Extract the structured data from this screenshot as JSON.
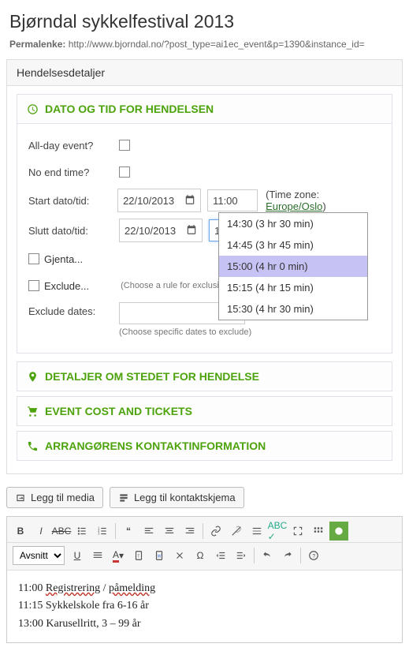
{
  "page_title": "Bjørndal sykkelfestival 2013",
  "permalink": {
    "label": "Permalenke:",
    "url": "http://www.bjorndal.no/?post_type=ai1ec_event&p=1390&instance_id="
  },
  "panel_title": "Hendelsesdetaljer",
  "sections": {
    "datetime": {
      "title": "DATO OG TID FOR HENDELSEN",
      "all_day_label": "All-day event?",
      "no_end_label": "No end time?",
      "start_label": "Start dato/tid:",
      "start_date": "22/10/2013",
      "start_time": "11:00",
      "tz_label": "(Time zone:",
      "tz_link": "Europe/Oslo",
      "tz_close": ")",
      "end_label": "Slutt dato/tid:",
      "end_date": "22/10/2013",
      "end_time": "15:00",
      "repeat_label": "Gjenta...",
      "exclude_label": "Exclude...",
      "exclude_hint": "(Choose a rule for exclusion)",
      "exclude_dates_label": "Exclude dates:",
      "exclude_dates_hint": "(Choose specific dates to exclude)",
      "time_options": [
        {
          "label": "14:30 (3 hr 30 min)"
        },
        {
          "label": "14:45 (3 hr 45 min)"
        },
        {
          "label": "15:00 (4 hr 0 min)",
          "selected": true
        },
        {
          "label": "15:15 (4 hr 15 min)"
        },
        {
          "label": "15:30 (4 hr 30 min)"
        }
      ]
    },
    "venue": {
      "title": "DETALJER OM STEDET FOR HENDELSE"
    },
    "cost": {
      "title": "EVENT COST AND TICKETS"
    },
    "organizer": {
      "title": "ARRANGØRENS KONTAKTINFORMATION"
    }
  },
  "buttons": {
    "add_media": "Legg til media",
    "add_contact_form": "Legg til kontaktskjema"
  },
  "editor": {
    "format_select": "Avsnitt",
    "content_lines": [
      "11:00 Registrering / påmelding",
      "11:15 Sykkelskole fra 6-16 år",
      "13:00 Karusellritt, 3 – 99 år"
    ]
  }
}
